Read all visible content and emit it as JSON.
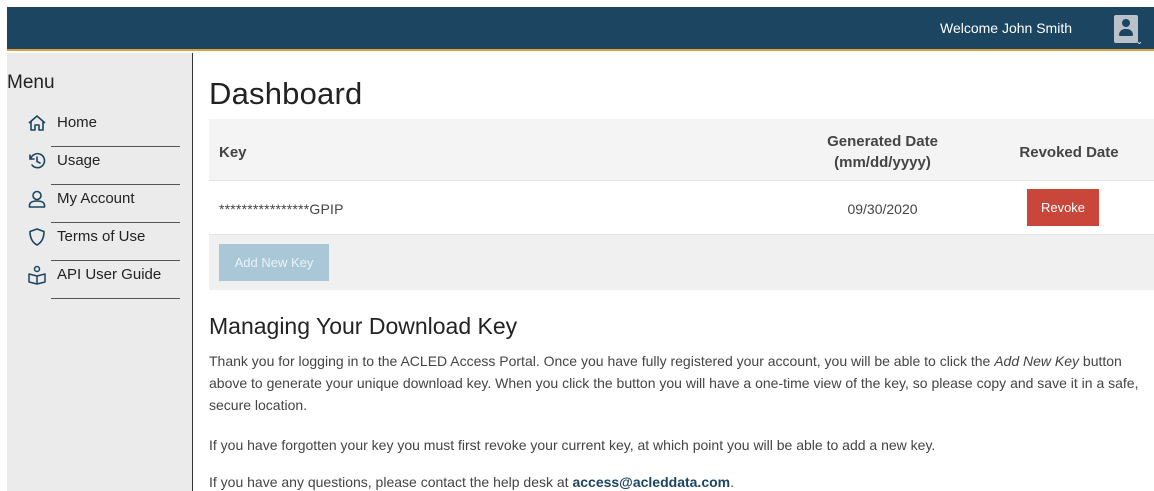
{
  "header": {
    "welcome": "Welcome John Smith",
    "user_icon": "user-avatar-icon",
    "accent_color": "#1b4560"
  },
  "sidebar": {
    "title": "Menu",
    "items": [
      {
        "label": "Home",
        "icon": "home-icon"
      },
      {
        "label": "Usage",
        "icon": "history-icon"
      },
      {
        "label": "My Account",
        "icon": "user-icon"
      },
      {
        "label": "Terms of Use",
        "icon": "shield-icon"
      },
      {
        "label": "API User Guide",
        "icon": "api-guide-icon"
      }
    ]
  },
  "main": {
    "title": "Dashboard",
    "table": {
      "headers": {
        "key": "Key",
        "generated_line1": "Generated Date",
        "generated_line2": "(mm/dd/yyyy)",
        "revoked": "Revoked Date"
      },
      "rows": [
        {
          "key": "****************GPIP",
          "generated": "09/30/2020",
          "action": "Revoke"
        }
      ],
      "add_button": "Add New Key"
    },
    "section_title": "Managing Your Download Key",
    "paragraphs": {
      "p1_before": "Thank you for logging in to the ACLED Access Portal. Once you have fully registered your account, you will be able to click the ",
      "p1_emphasis": "Add New Key",
      "p1_after": " button above to generate your unique download key. When you click the button you will have a one-time view of the key, so please copy and save it in a safe, secure location.",
      "p2": "If you have forgotten your key you must first revoke your current key, at which point you will be able to add a new key.",
      "p3_before": "If you have any questions, please contact the help desk at ",
      "p3_email": "access@acleddata.com",
      "p3_after": "."
    }
  },
  "colors": {
    "topbar": "#1b4560",
    "topbar_accent": "#e0a13a",
    "revoke": "#c9473a",
    "add_disabled": "#a9c7d6"
  }
}
